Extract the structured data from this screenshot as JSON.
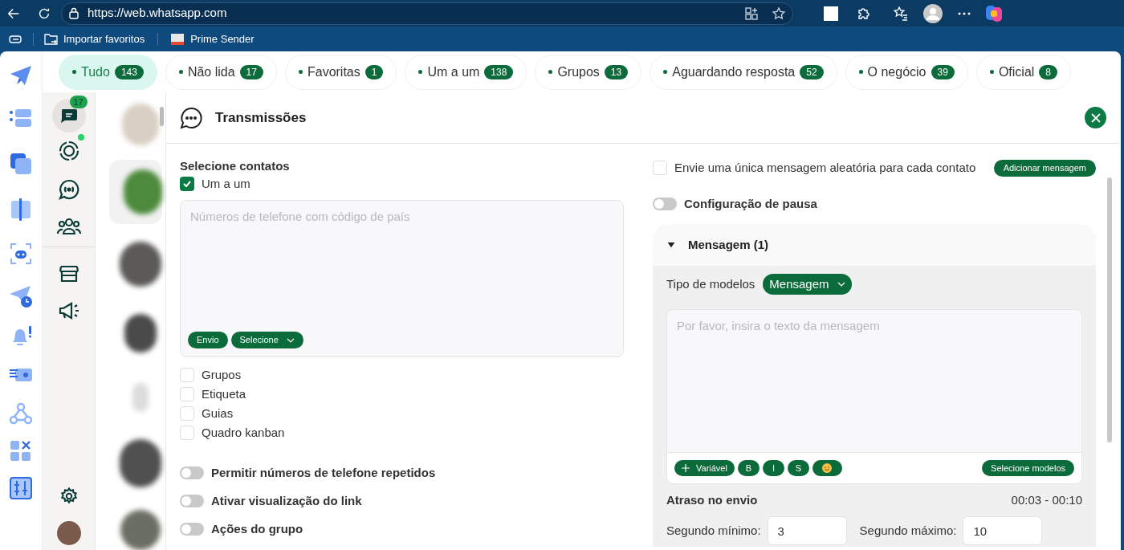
{
  "browser": {
    "url": "https://web.whatsapp.com",
    "bookmarks": [
      "Importar favoritos",
      "Prime Sender"
    ]
  },
  "filters": [
    {
      "label": "Tudo",
      "count": "143",
      "selected": true
    },
    {
      "label": "Não lida",
      "count": "17",
      "selected": false
    },
    {
      "label": "Favoritas",
      "count": "1",
      "selected": false
    },
    {
      "label": "Um a um",
      "count": "138",
      "selected": false
    },
    {
      "label": "Grupos",
      "count": "13",
      "selected": false
    },
    {
      "label": "Aguardando resposta",
      "count": "52",
      "selected": false
    },
    {
      "label": "O negócio",
      "count": "39",
      "selected": false
    },
    {
      "label": "Oficial",
      "count": "8",
      "selected": false
    }
  ],
  "nav": {
    "unread_badge": "17"
  },
  "panel": {
    "title": "Transmissões",
    "contacts": {
      "heading": "Selecione contatos",
      "options": [
        {
          "label": "Um a um",
          "checked": true
        },
        {
          "label": "Grupos",
          "checked": false
        },
        {
          "label": "Etiqueta",
          "checked": false
        },
        {
          "label": "Guias",
          "checked": false
        },
        {
          "label": "Quadro kanban",
          "checked": false
        }
      ],
      "phone_field": {
        "placeholder": "Números de telefone com código de país",
        "send_button": "Envio",
        "select_button": "Selecione"
      }
    },
    "toggles": [
      {
        "label": "Permitir números de telefone repetidos",
        "on": false
      },
      {
        "label": "Ativar visualização do link",
        "on": false
      },
      {
        "label": "Ações do grupo",
        "on": false
      }
    ],
    "random_message": {
      "label": "Envie uma única mensagem aleatória para cada contato",
      "checked": false,
      "button": "Adicionar mensagem"
    },
    "pause": {
      "label": "Configuração de pausa",
      "on": false
    },
    "message": {
      "title": "Mensagem (1)",
      "expanded": true,
      "type_label": "Tipo de modelos",
      "type_value": "Mensagem",
      "placeholder": "Por favor, insira o texto da mensagem",
      "variable_button": "Variável",
      "format_buttons": [
        "B",
        "I",
        "S"
      ],
      "templates_button": "Selecione modelos"
    },
    "delay": {
      "label": "Atraso no envio",
      "range": "00:03 - 00:10",
      "min_label": "Segundo mínimo:",
      "min_value": "3",
      "max_label": "Segundo máximo:",
      "max_value": "10"
    }
  }
}
